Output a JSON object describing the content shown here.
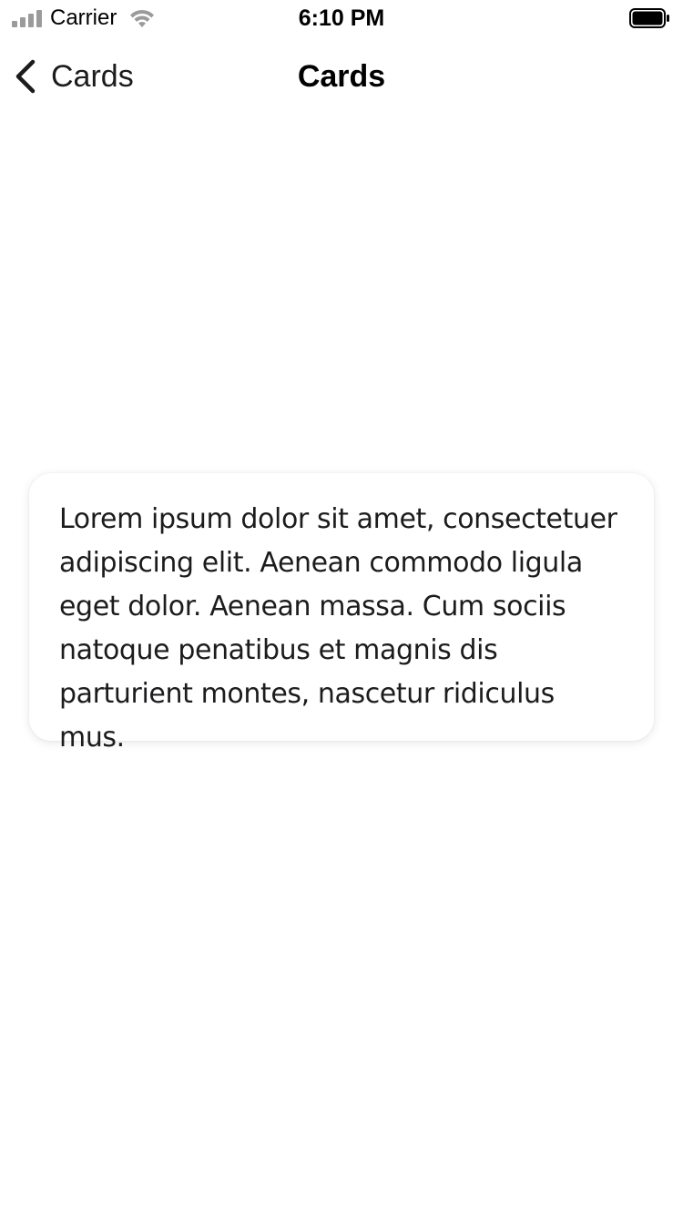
{
  "status_bar": {
    "carrier": "Carrier",
    "time": "6:10 PM",
    "signal_icon": "cellular-signal-icon",
    "wifi_icon": "wifi-icon",
    "battery_icon": "battery-icon",
    "battery_level": 1.0
  },
  "nav": {
    "back_label": "Cards",
    "back_icon": "chevron-left-icon",
    "title": "Cards"
  },
  "card": {
    "text": "Lorem ipsum dolor sit amet, consectetuer adipiscing elit. Aenean commodo ligula eget dolor. Aenean massa. Cum sociis natoque penatibus et magnis dis parturient montes, nascetur ridiculus mus."
  },
  "colors": {
    "background": "#ffffff",
    "text": "#1c1c1e",
    "status_inactive": "#9b9b9b"
  }
}
